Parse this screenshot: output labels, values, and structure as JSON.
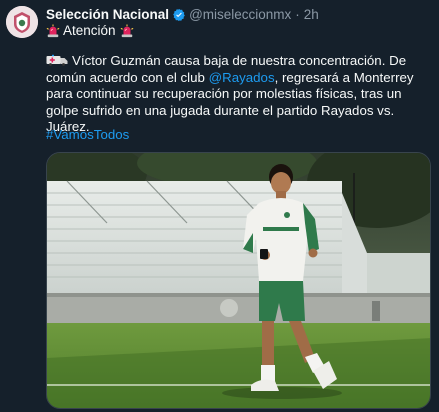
{
  "tweet": {
    "author_name": "Selección Nacional",
    "handle": "@miseleccionmx",
    "separator": "·",
    "time": "2h",
    "alert_text": "Atención",
    "body_before_mention": "Víctor Guzmán causa baja de nuestra concentración. De común acuerdo con el club ",
    "mention": "@Rayados",
    "body_after_mention": ", regresará a Monterrey para continuar su recuperación por molestias físicas, tras un golpe sufrido en una jugada durante el partido Rayados vs. Juárez.",
    "hashtag": "#VamosTodos"
  },
  "icons": {
    "avatar": "federation-crest-avatar",
    "verified": "verified-badge-icon",
    "alert": "rotating-light-icon",
    "ambulance": "ambulance-icon"
  },
  "colors": {
    "background": "#15202b",
    "text": "#f7f9f9",
    "secondary_text": "#8b98a5",
    "link": "#1d9bf0",
    "verified": "#1d9bf0",
    "siren_red": "#e0245e"
  }
}
